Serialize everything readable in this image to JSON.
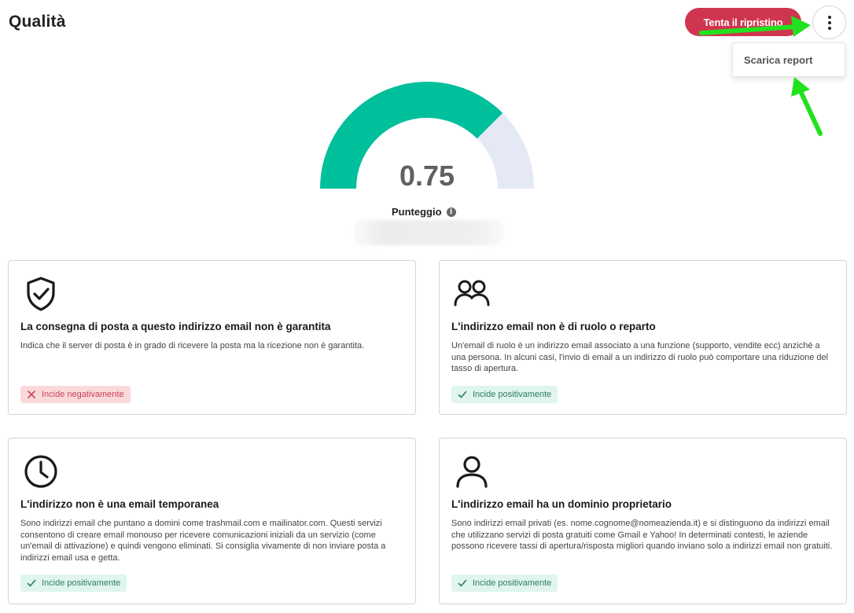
{
  "header": {
    "title": "Qualità",
    "retry_label": "Tenta il ripristino"
  },
  "menu": {
    "items": [
      {
        "label": "Scarica report"
      }
    ]
  },
  "score": {
    "value": "0.75",
    "fraction": 0.75,
    "label": "Punteggio",
    "info_glyph": "i",
    "colors": {
      "fill": "#00bf9b",
      "track": "#e4e9f5"
    }
  },
  "cards": [
    {
      "icon": "shield-check-icon",
      "title": "La consegna di posta a questo indirizzo email non è garantita",
      "description": "Indica che il server di posta è in grado di ricevere la posta ma la ricezione non è garantita.",
      "badge": {
        "type": "negative",
        "label": "Incide negativamente"
      }
    },
    {
      "icon": "users-icon",
      "title": "L'indirizzo email non è di ruolo o reparto",
      "description": "Un'email di ruolo è un indirizzo email associato a una funzione (supporto, vendite ecc) anziché a una persona. In alcuni casi, l'invio di email a un indirizzo di ruolo può comportare una riduzione del tasso di apertura.",
      "badge": {
        "type": "positive",
        "label": "Incide positivamente"
      }
    },
    {
      "icon": "clock-icon",
      "title": "L'indirizzo non è una email temporanea",
      "description": "Sono indirizzi email che puntano a domini come trashmail.com e mailinator.com. Questi servizi consentono di creare email monouso per ricevere comunicazioni iniziali da un servizio (come un'email di attivazione) e quindi vengono eliminati. Si consiglia vivamente di non inviare posta a indirizzi email usa e getta.",
      "badge": {
        "type": "positive",
        "label": "Incide positivamente"
      }
    },
    {
      "icon": "user-icon",
      "title": "L'indirizzo email ha un dominio proprietario",
      "description": "Sono indirizzi email privati (es. nome.cognome@nomeazienda.it) e si distinguono da indirizzi email che utilizzano servizi di posta gratuiti come Gmail e Yahoo! In determinati contesti, le aziende possono ricevere tassi di apertura/risposta migliori quando inviano solo a indirizzi email non gratuiti.",
      "badge": {
        "type": "positive",
        "label": "Incide positivamente"
      }
    }
  ],
  "colors": {
    "primary_button": "#d0354f",
    "annotation_arrow": "#22e21f",
    "negative_bg": "#fbd9db",
    "positive_bg": "#dff5ee"
  }
}
